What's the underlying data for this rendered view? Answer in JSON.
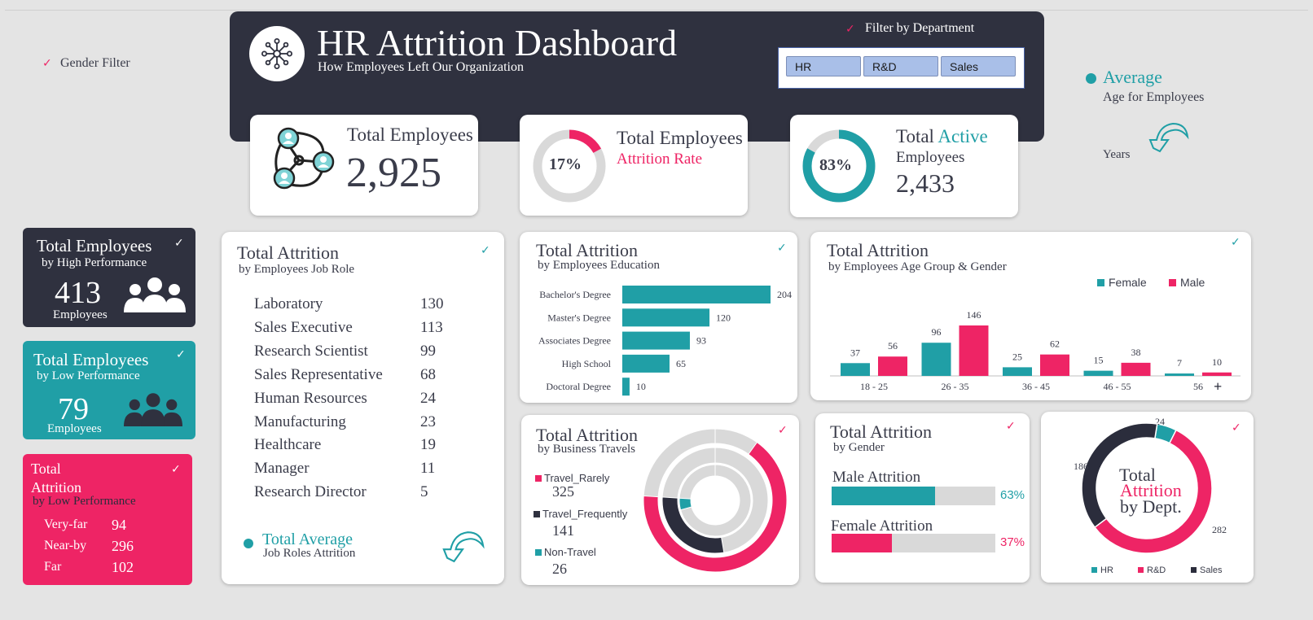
{
  "colors": {
    "navy": "#2b2d3c",
    "teal": "#209fa6",
    "pink": "#ee2465",
    "grey": "#d9d9d9"
  },
  "header": {
    "title": "HR Attrition Dashboard",
    "subtitle": "How Employees Left Our Organization",
    "logo_icon": "network-hub-icon"
  },
  "filters": {
    "gender_label": "Gender Filter",
    "department_label": "Filter by Department",
    "departments": [
      "HR",
      "R&D",
      "Sales"
    ]
  },
  "kpi": {
    "total": {
      "label": "Total Employees",
      "value": "2,925"
    },
    "attrition": {
      "label": "Total Employees",
      "sub": "Attrition Rate",
      "percent": "17%",
      "fraction": 0.17
    },
    "active": {
      "label_pre": "Total ",
      "label_accent": "Active",
      "sub": "Employees",
      "value": "2,433",
      "percent": "83%",
      "fraction": 0.83
    }
  },
  "average_age": {
    "title": "Average",
    "sub": "Age for Employees",
    "unit": "Years",
    "icon": "curved-arrow-icon"
  },
  "high_perf": {
    "title": "Total Employees",
    "sub": "by High Performance",
    "value": "413",
    "unit": "Employees",
    "icon": "people-group-icon"
  },
  "low_perf": {
    "title": "Total Employees",
    "sub": "by Low Performance",
    "value": "79",
    "unit": "Employees",
    "icon": "people-group-icon"
  },
  "distance": {
    "title1": "Total",
    "title2": "Attrition",
    "sub": "by Low Performance",
    "rows": [
      {
        "label": "Very-far",
        "value": "94"
      },
      {
        "label": "Near-by",
        "value": "296"
      },
      {
        "label": "Far",
        "value": "102"
      }
    ]
  },
  "job_role": {
    "title": "Total Attrition",
    "sub": "by Employees Job Role",
    "rows": [
      {
        "label": "Laboratory",
        "value": "130"
      },
      {
        "label": "Sales Executive",
        "value": "113"
      },
      {
        "label": "Research Scientist",
        "value": "99"
      },
      {
        "label": "Sales Representative",
        "value": "68"
      },
      {
        "label": "Human Resources",
        "value": "24"
      },
      {
        "label": "Manufacturing",
        "value": "23"
      },
      {
        "label": "Healthcare",
        "value": "19"
      },
      {
        "label": "Manager",
        "value": "11"
      },
      {
        "label": "Research Director",
        "value": "5"
      }
    ],
    "footer_title": "Total Average",
    "footer_sub": "Job Roles Attrition"
  },
  "education": {
    "title": "Total Attrition",
    "sub": "by Employees Education"
  },
  "age_gender": {
    "title": "Total Attrition",
    "sub": "by Employees Age Group & Gender"
  },
  "travel": {
    "title": "Total Attrition",
    "sub": "by Business Travels",
    "items": [
      {
        "label": "Travel_Rarely",
        "value": "325"
      },
      {
        "label": "Travel_Frequently",
        "value": "141"
      },
      {
        "label": "Non-Travel",
        "value": "26"
      }
    ]
  },
  "gender": {
    "title": "Total Attrition",
    "sub": "by Gender",
    "rows": [
      {
        "label": "Male Attrition",
        "percent": "63%",
        "fraction": 0.63
      },
      {
        "label": "Female Attrition",
        "percent": "37%",
        "fraction": 0.37
      }
    ]
  },
  "dept": {
    "center1": "Total",
    "center2": "Attrition",
    "center3": "by Dept."
  },
  "chart_data": [
    {
      "type": "bar",
      "orientation": "horizontal",
      "categories": [
        "Bachelor's Degree",
        "Master's Degree",
        "Associates Degree",
        "High School",
        "Doctoral Degree"
      ],
      "values": [
        204,
        120,
        93,
        65,
        10
      ]
    },
    {
      "type": "bar",
      "categories": [
        "18 - 25",
        "26 - 35",
        "36 - 45",
        "46 - 55",
        "56"
      ],
      "series": [
        {
          "name": "Female",
          "values": [
            37,
            96,
            25,
            15,
            7
          ]
        },
        {
          "name": "Male",
          "values": [
            56,
            146,
            62,
            38,
            10
          ]
        }
      ],
      "legend": "top-right"
    },
    {
      "type": "pie",
      "variant": "nested-donut",
      "categories": [
        "Travel_Rarely",
        "Travel_Frequently",
        "Non-Travel"
      ],
      "values": [
        325,
        141,
        26
      ]
    },
    {
      "type": "pie",
      "variant": "donut",
      "categories": [
        "HR",
        "R&D",
        "Sales"
      ],
      "values": [
        24,
        282,
        186
      ],
      "legend": "bottom"
    }
  ]
}
